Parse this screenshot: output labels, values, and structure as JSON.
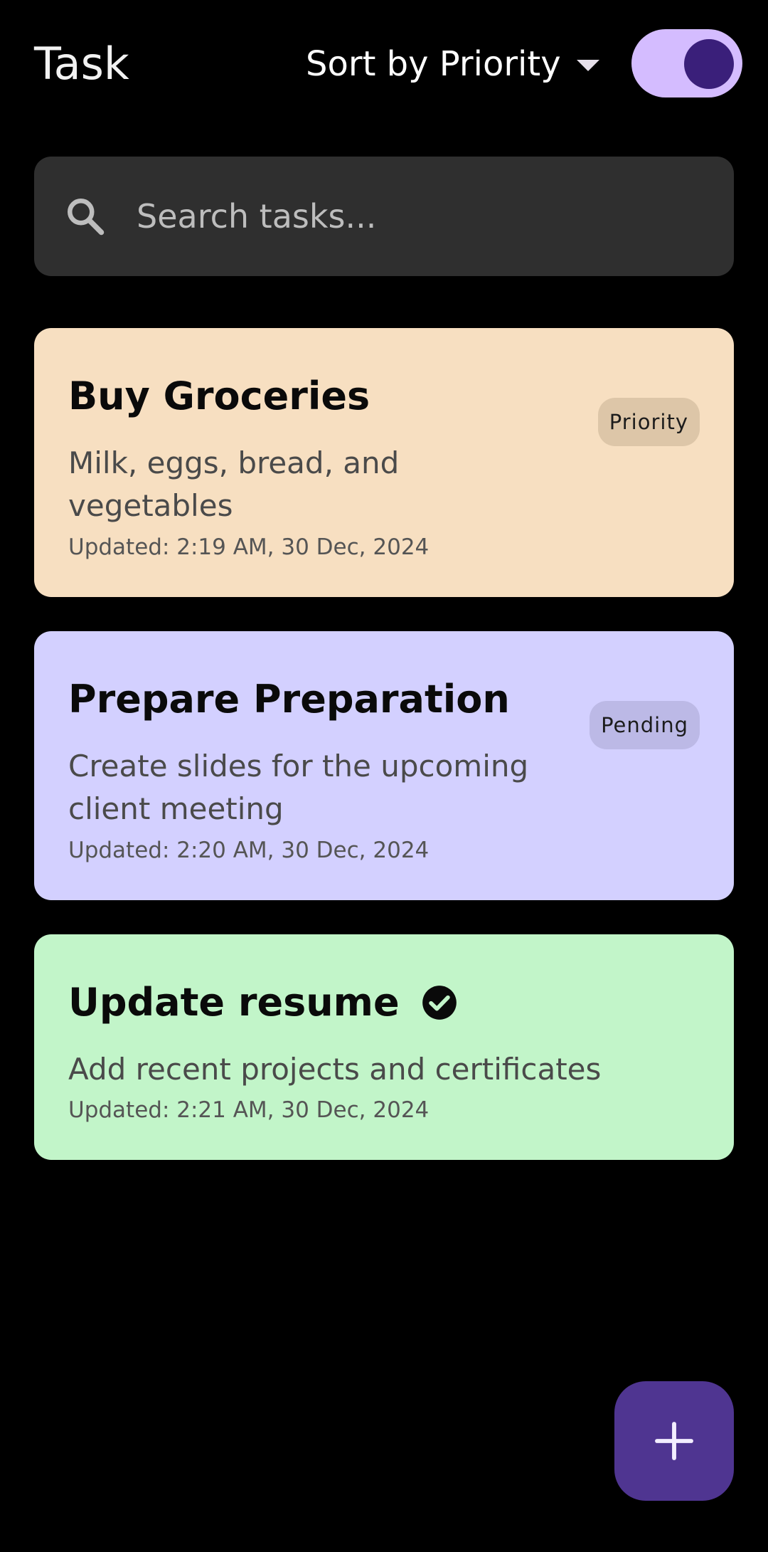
{
  "header": {
    "title": "Task",
    "sort_label": "Sort by Priority",
    "dropdown_icon": "caret-down-icon",
    "toggle": {
      "state": "on",
      "track_color": "#d4bcff",
      "knob_color": "#3a1f7a"
    }
  },
  "search": {
    "placeholder": "Search tasks...",
    "value": "",
    "icon": "search-icon"
  },
  "tasks": [
    {
      "title": "Buy Groceries",
      "description_lines": [
        "Milk, eggs, bread, and",
        "vegetables"
      ],
      "updated": "Updated: 2:19 AM, 30 Dec, 2024",
      "badge": "Priority",
      "completed": false,
      "color": "#f7dfc1",
      "badge_color": "#ddc6a8"
    },
    {
      "title": "Prepare Preparation",
      "description_lines": [
        "Create slides for the upcoming",
        "client meeting"
      ],
      "updated": "Updated: 2:20 AM, 30 Dec, 2024",
      "badge": "Pending",
      "completed": false,
      "color": "#d3d0ff",
      "badge_color": "#bcb9e6"
    },
    {
      "title": "Update resume",
      "description_lines": [
        "Add recent projects and certificates"
      ],
      "updated": "Updated: 2:21 AM, 30 Dec, 2024",
      "badge": "",
      "completed": true,
      "completed_icon": "check-circle-icon",
      "color": "#c2f5c9"
    }
  ],
  "fab": {
    "icon": "plus-icon",
    "color": "#4f3591",
    "icon_color": "#f3eeff"
  },
  "colors": {
    "background": "#000000",
    "search_background": "#2f2f2f"
  }
}
